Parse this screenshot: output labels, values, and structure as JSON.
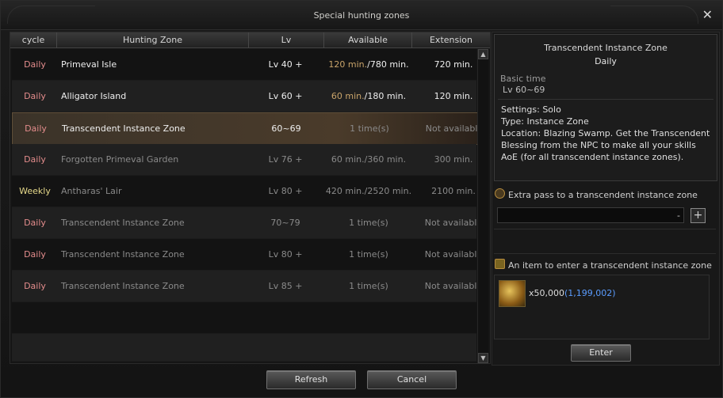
{
  "window": {
    "title": "Special hunting zones",
    "close_symbol": "✕"
  },
  "table": {
    "headers": [
      "cycle",
      "Hunting Zone",
      "Lv",
      "Available",
      "Extension"
    ],
    "rows": [
      {
        "cycle": "Daily",
        "zone": "Primeval Isle",
        "lv": "Lv 40 +",
        "av_a": "120 min.",
        "av_b": "/780 min.",
        "ext": "720 min.",
        "state": "active"
      },
      {
        "cycle": "Daily",
        "zone": "Alligator Island",
        "lv": "Lv 60 +",
        "av_a": "60 min.",
        "av_b": "/180 min.",
        "ext": "120 min.",
        "state": "active"
      },
      {
        "cycle": "Daily",
        "zone": "Transcendent Instance Zone",
        "lv": "60~69",
        "av_a": "1  time(s)",
        "av_b": "",
        "ext": "Not available",
        "state": "selected"
      },
      {
        "cycle": "Daily",
        "zone": "Forgotten Primeval Garden",
        "lv": "Lv 76 +",
        "av_a": "60 min./360 min.",
        "av_b": "",
        "ext": "300 min.",
        "state": "disabled"
      },
      {
        "cycle": "Weekly",
        "zone": "Antharas' Lair",
        "lv": "Lv 80 +",
        "av_a": "420 min./2520 min.",
        "av_b": "",
        "ext": "2100 min.",
        "state": "disabled"
      },
      {
        "cycle": "Daily",
        "zone": "Transcendent Instance Zone",
        "lv": "70~79",
        "av_a": "1  time(s)",
        "av_b": "",
        "ext": "Not available",
        "state": "disabled"
      },
      {
        "cycle": "Daily",
        "zone": "Transcendent Instance Zone",
        "lv": "Lv 80 +",
        "av_a": "1  time(s)",
        "av_b": "",
        "ext": "Not available",
        "state": "disabled"
      },
      {
        "cycle": "Daily",
        "zone": "Transcendent Instance Zone",
        "lv": "Lv 85 +",
        "av_a": "1  time(s)",
        "av_b": "",
        "ext": "Not available",
        "state": "disabled"
      }
    ]
  },
  "buttons": {
    "refresh": "Refresh",
    "cancel": "Cancel",
    "enter": "Enter",
    "plus": "+"
  },
  "detail": {
    "title": "Transcendent Instance Zone",
    "subtitle": "Daily",
    "basic_time_label": "Basic time",
    "basic_time_value": "Lv  60~69",
    "settings": "Settings: Solo",
    "type": "Type: Instance Zone",
    "location": "Location: Blazing Swamp. Get the Transcendent Blessing from the NPC to make all your skills AoE (for all transcendent instance zones).",
    "extra_pass_label": "Extra pass to a transcendent instance zone",
    "pass_input_value": "-",
    "item_label": "An item to enter a transcendent instance zone",
    "item_qty": "x50,000",
    "item_owned": "(1,199,002)"
  }
}
